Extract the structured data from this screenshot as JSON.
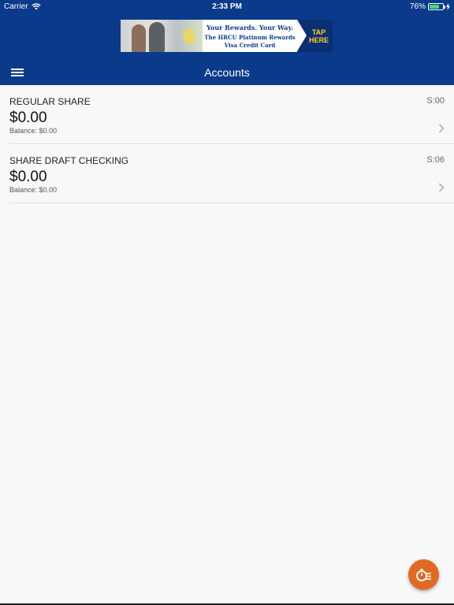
{
  "status_bar": {
    "carrier": "Carrier",
    "time": "2:33 PM",
    "battery_percent": "76%",
    "battery_level": 0.76
  },
  "banner": {
    "line1": "Your Rewards. Your Way.",
    "line2": "The HRCU Platinum Rewards",
    "line3": "Visa Credit Card",
    "cta_line1": "TAP",
    "cta_line2": "HERE"
  },
  "header": {
    "title": "Accounts"
  },
  "accounts": [
    {
      "name": "REGULAR SHARE",
      "id": "S:00",
      "amount": "$0.00",
      "balance": "Balance: $0.00"
    },
    {
      "name": "SHARE DRAFT CHECKING",
      "id": "S:06",
      "amount": "$0.00",
      "balance": "Balance: $0.00"
    }
  ],
  "colors": {
    "header_bg": "#0c3a8a",
    "fab_bg": "#e06a24",
    "battery_green": "#4cd964",
    "cta_yellow": "#ffd21f"
  },
  "icons": {
    "menu": "hamburger-menu-icon",
    "chevron": "chevron-right-icon",
    "fab": "quick-balance-icon",
    "wifi": "wifi-icon",
    "battery": "battery-icon",
    "charging": "charging-bolt-icon"
  }
}
